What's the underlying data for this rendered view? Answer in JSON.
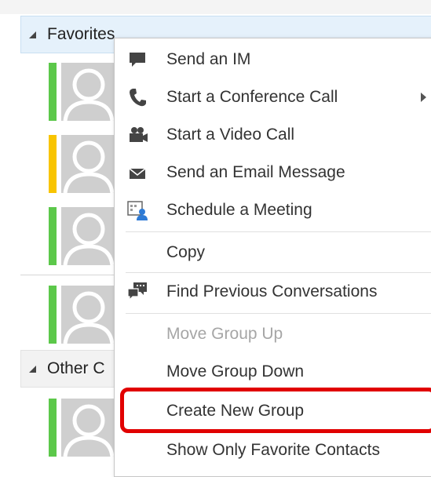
{
  "contact_list": {
    "groups": {
      "favorites": {
        "label": "Favorites"
      },
      "other": {
        "label": "Other C"
      }
    },
    "favorite_contacts": [
      {
        "presence": "available",
        "presence_color": "#5cc84a"
      },
      {
        "presence": "away",
        "presence_color": "#f8c400"
      },
      {
        "presence": "available",
        "presence_color": "#5cc84a"
      },
      {
        "presence": "available",
        "presence_color": "#5cc84a"
      }
    ],
    "other_contacts": [
      {
        "presence": "available",
        "presence_color": "#5cc84a"
      }
    ]
  },
  "context_menu": {
    "items": [
      {
        "label": "Send an IM",
        "icon": "im-bubble-icon",
        "enabled": true
      },
      {
        "label": "Start a Conference Call",
        "icon": "phone-icon",
        "enabled": true,
        "has_submenu": true
      },
      {
        "label": "Start a Video Call",
        "icon": "video-call-icon",
        "enabled": true
      },
      {
        "label": "Send an Email Message",
        "icon": "email-icon",
        "enabled": true
      },
      {
        "label": "Schedule a Meeting",
        "icon": "meeting-icon",
        "enabled": true
      },
      {
        "label": "Copy",
        "icon": null,
        "enabled": true
      },
      {
        "label": "Find Previous Conversations",
        "icon": "conversation-history-icon",
        "enabled": true
      },
      {
        "label": "Move Group Up",
        "icon": null,
        "enabled": false
      },
      {
        "label": "Move Group Down",
        "icon": null,
        "enabled": true
      },
      {
        "label": "Create New Group",
        "icon": null,
        "enabled": true,
        "highlighted": true
      },
      {
        "label": "Show Only Favorite Contacts",
        "icon": null,
        "enabled": true
      }
    ]
  },
  "colors": {
    "highlight_border": "#e10000",
    "header_bg": "#e5f1fb",
    "icon": "#444444",
    "meeting_icon_accent": "#2e7bd6"
  }
}
